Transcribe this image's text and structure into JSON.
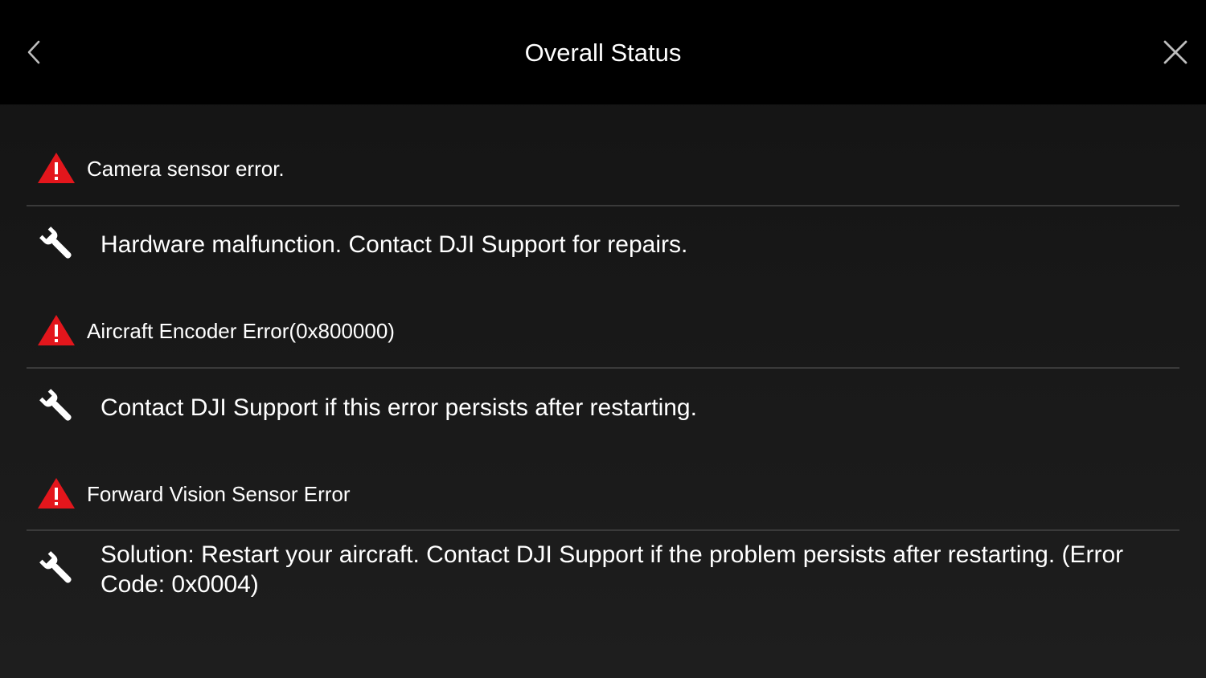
{
  "header": {
    "title": "Overall Status",
    "back_icon": "chevron-left-icon",
    "close_icon": "close-icon"
  },
  "colors": {
    "header_bg": "#000000",
    "body_bg": "#1b1b1b",
    "warning_red": "#e3161c",
    "divider": "#3a3a3a",
    "text": "#ffffff"
  },
  "issues": [
    {
      "error": "Camera sensor error.",
      "solution": "Hardware malfunction. Contact DJI Support for repairs."
    },
    {
      "error": "Aircraft Encoder Error(0x800000)",
      "solution": "Contact DJI Support if this error persists after restarting."
    },
    {
      "error": "Forward Vision Sensor Error",
      "solution": "Solution: Restart your aircraft. Contact DJI Support if the problem persists after restarting. (Error Code: 0x0004)"
    }
  ]
}
